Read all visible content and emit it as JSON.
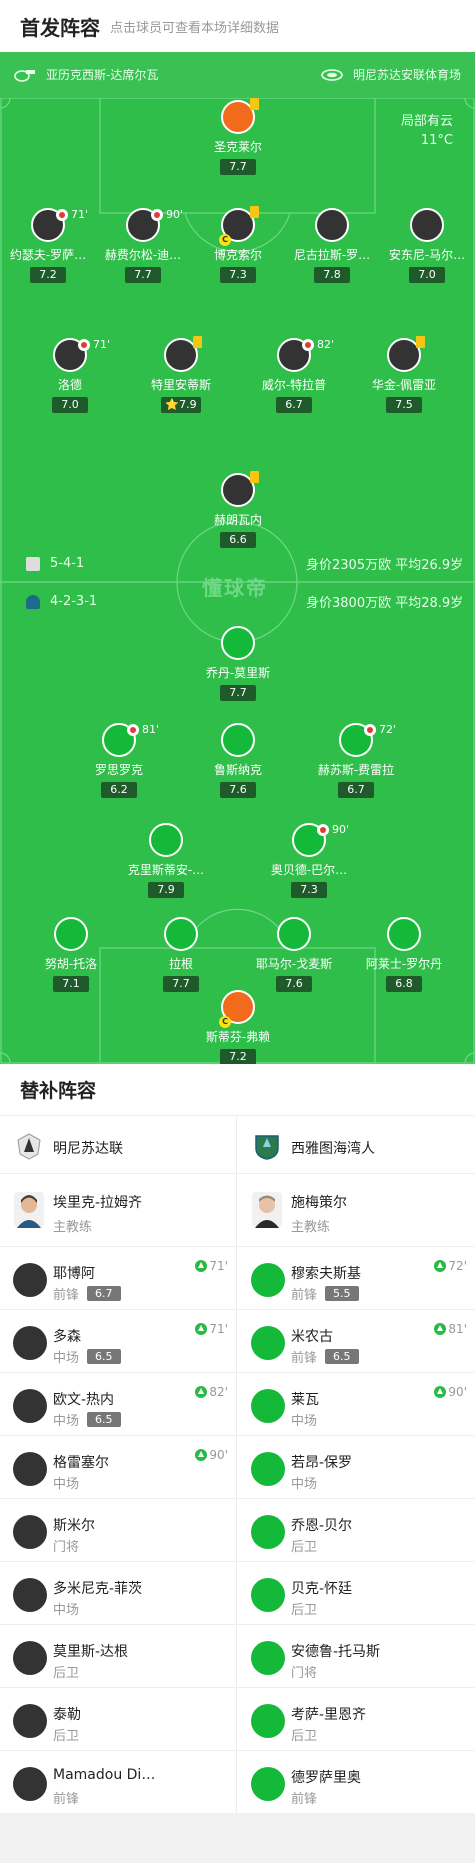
{
  "header": {
    "title": "首发阵容",
    "subtitle": "点击球员可查看本场详细数据"
  },
  "match_info": {
    "referee": "亚历克西斯-达席尔瓦",
    "venue": "明尼苏达安联体育场",
    "weather": "局部有云",
    "temperature": "11°C",
    "watermark": "懂球帝"
  },
  "teams": {
    "away": {
      "formation": "5-4-1",
      "value": "身价2305万欧 平均26.9岁"
    },
    "home": {
      "formation": "4-2-3-1",
      "value": "身价3800万欧 平均28.9岁"
    }
  },
  "away_lineup": [
    {
      "name": "圣克莱尔",
      "rating": "7.7",
      "card": "yellow"
    },
    {
      "name": "约瑟夫-罗萨…",
      "rating": "7.2",
      "sub_min": "71'"
    },
    {
      "name": "赫费尔松-迪…",
      "rating": "7.7",
      "sub_min": "90'"
    },
    {
      "name": "博克索尔",
      "rating": "7.3",
      "card": "yellow",
      "captain": "C"
    },
    {
      "name": "尼古拉斯-罗…",
      "rating": "7.8"
    },
    {
      "name": "安东尼-马尔…",
      "rating": "7.0"
    },
    {
      "name": "洛德",
      "rating": "7.0",
      "sub_min": "71'"
    },
    {
      "name": "特里安蒂斯",
      "rating": "7.9",
      "card": "yellow",
      "star": "⭐"
    },
    {
      "name": "威尔-特拉普",
      "rating": "6.7",
      "sub_min": "82'"
    },
    {
      "name": "华金-佩雷亚",
      "rating": "7.5",
      "card": "yellow"
    },
    {
      "name": "赫朗瓦内",
      "rating": "6.6",
      "card": "yellow"
    }
  ],
  "home_lineup": [
    {
      "name": "乔丹-莫里斯",
      "rating": "7.7"
    },
    {
      "name": "罗思罗克",
      "rating": "6.2",
      "sub_min": "81'"
    },
    {
      "name": "鲁斯纳克",
      "rating": "7.6"
    },
    {
      "name": "赫苏斯-费雷拉",
      "rating": "6.7",
      "sub_min": "72'"
    },
    {
      "name": "克里斯蒂安-…",
      "rating": "7.9"
    },
    {
      "name": "奥贝德-巴尔…",
      "rating": "7.3",
      "sub_min": "90'"
    },
    {
      "name": "努胡-托洛",
      "rating": "7.1"
    },
    {
      "name": "拉根",
      "rating": "7.7"
    },
    {
      "name": "耶马尔-戈麦斯",
      "rating": "7.6"
    },
    {
      "name": "阿莱士-罗尔丹",
      "rating": "6.8"
    },
    {
      "name": "斯蒂芬-弗赖",
      "rating": "7.2",
      "captain": "C"
    }
  ],
  "substitutes": {
    "title": "替补阵容",
    "left": {
      "team": "明尼苏达联",
      "coach": {
        "name": "埃里克-拉姆齐",
        "role": "主教练"
      },
      "players": [
        {
          "name": "耶博阿",
          "pos": "前锋",
          "rating": "6.7",
          "in": "71'"
        },
        {
          "name": "多森",
          "pos": "中场",
          "rating": "6.5",
          "in": "71'"
        },
        {
          "name": "欧文-热内",
          "pos": "中场",
          "rating": "6.5",
          "in": "82'"
        },
        {
          "name": "格雷塞尔",
          "pos": "中场",
          "in": "90'"
        },
        {
          "name": "斯米尔",
          "pos": "门将"
        },
        {
          "name": "多米尼克-菲茨",
          "pos": "中场"
        },
        {
          "name": "莫里斯-达根",
          "pos": "后卫"
        },
        {
          "name": "泰勒",
          "pos": "后卫"
        },
        {
          "name": "Mamadou Di…",
          "pos": "前锋"
        }
      ]
    },
    "right": {
      "team": "西雅图海湾人",
      "coach": {
        "name": "施梅策尔",
        "role": "主教练"
      },
      "players": [
        {
          "name": "穆索夫斯基",
          "pos": "前锋",
          "rating": "5.5",
          "in": "72'"
        },
        {
          "name": "米农古",
          "pos": "前锋",
          "rating": "6.5",
          "in": "81'"
        },
        {
          "name": "莱瓦",
          "pos": "中场",
          "in": "90'"
        },
        {
          "name": "若昂-保罗",
          "pos": "中场"
        },
        {
          "name": "乔恩-贝尔",
          "pos": "后卫"
        },
        {
          "name": "贝克-怀廷",
          "pos": "后卫"
        },
        {
          "name": "安德鲁-托马斯",
          "pos": "门将"
        },
        {
          "name": "考萨-里恩齐",
          "pos": "后卫"
        },
        {
          "name": "德罗萨里奥",
          "pos": "前锋"
        }
      ]
    }
  },
  "colors": {
    "pitch": "#2fbe4a",
    "away_kit": "#333333",
    "home_kit": "#15b93a",
    "keeper": "#f26a1b",
    "yellow_card": "#f7c514"
  }
}
